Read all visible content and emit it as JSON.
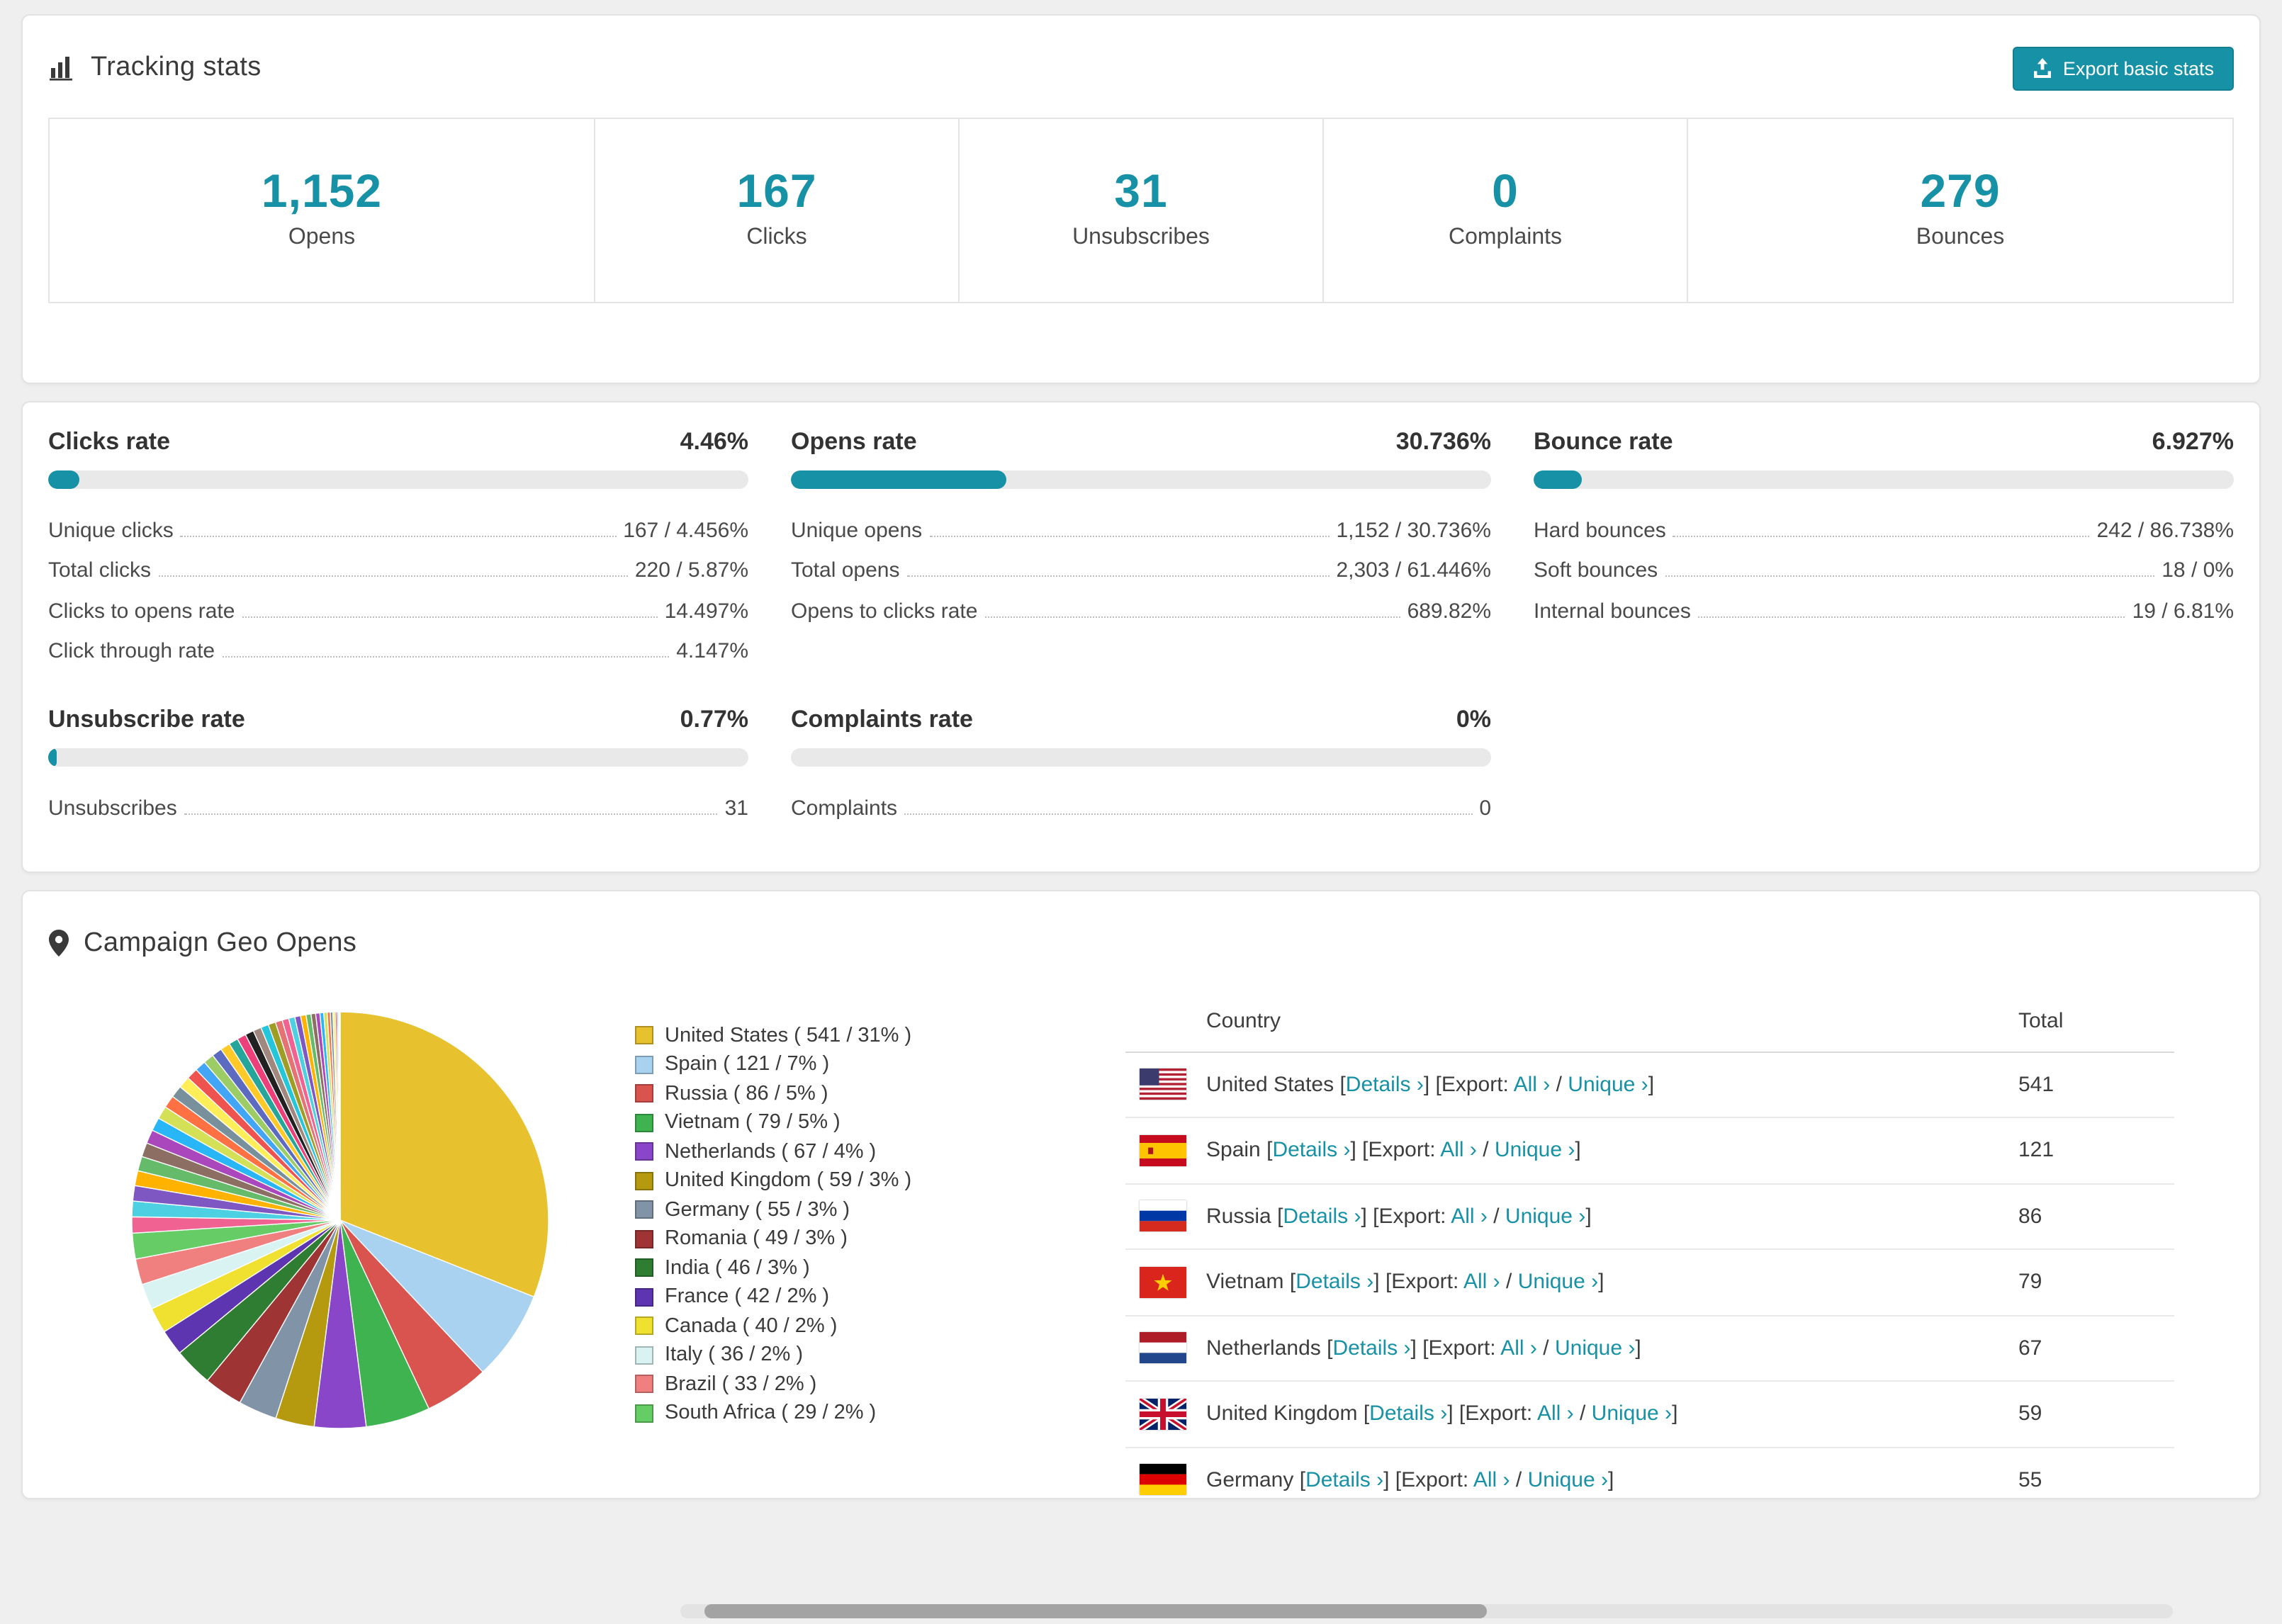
{
  "app": {
    "accent_color": "#1791a5",
    "background_color": "#efefef"
  },
  "tracking": {
    "title": "Tracking stats",
    "export_button": "Export basic stats",
    "stats": [
      {
        "value": "1,152",
        "label": "Opens"
      },
      {
        "value": "167",
        "label": "Clicks"
      },
      {
        "value": "31",
        "label": "Unsubscribes"
      },
      {
        "value": "0",
        "label": "Complaints"
      },
      {
        "value": "279",
        "label": "Bounces"
      }
    ]
  },
  "rates": {
    "panels": [
      {
        "title": "Clicks rate",
        "value": "4.46%",
        "percent": 4.46,
        "rows": [
          {
            "label": "Unique clicks",
            "value": "167 / 4.456%"
          },
          {
            "label": "Total clicks",
            "value": "220 / 5.87%"
          },
          {
            "label": "Clicks to opens rate",
            "value": "14.497%"
          },
          {
            "label": "Click through rate",
            "value": "4.147%"
          }
        ]
      },
      {
        "title": "Opens rate",
        "value": "30.736%",
        "percent": 30.736,
        "rows": [
          {
            "label": "Unique opens",
            "value": "1,152 / 30.736%"
          },
          {
            "label": "Total opens",
            "value": "2,303 / 61.446%"
          },
          {
            "label": "Opens to clicks rate",
            "value": "689.82%"
          }
        ]
      },
      {
        "title": "Bounce rate",
        "value": "6.927%",
        "percent": 6.927,
        "rows": [
          {
            "label": "Hard bounces",
            "value": "242 / 86.738%"
          },
          {
            "label": "Soft bounces",
            "value": "18 / 0%"
          },
          {
            "label": "Internal bounces",
            "value": "19 / 6.81%"
          }
        ]
      },
      {
        "title": "Unsubscribe rate",
        "value": "0.77%",
        "percent": 0.77,
        "rows": [
          {
            "label": "Unsubscribes",
            "value": "31"
          }
        ]
      },
      {
        "title": "Complaints rate",
        "value": "0%",
        "percent": 0,
        "rows": [
          {
            "label": "Complaints",
            "value": "0"
          }
        ]
      }
    ]
  },
  "geo": {
    "title": "Campaign Geo Opens",
    "table": {
      "country_header": "Country",
      "total_header": "Total",
      "details_label": "Details ›",
      "export_prefix": "[Export:",
      "all_label": "All ›",
      "slash": "/",
      "unique_label": "Unique ›",
      "bracket_open": "[",
      "bracket_close": "]",
      "rows": [
        {
          "country": "United States",
          "flag": "us",
          "total": "541"
        },
        {
          "country": "Spain",
          "flag": "es",
          "total": "121"
        },
        {
          "country": "Russia",
          "flag": "ru",
          "total": "86"
        },
        {
          "country": "Vietnam",
          "flag": "vn",
          "total": "79"
        },
        {
          "country": "Netherlands",
          "flag": "nl",
          "total": "67"
        },
        {
          "country": "United Kingdom",
          "flag": "gb",
          "total": "59"
        },
        {
          "country": "Germany",
          "flag": "de",
          "total": "55"
        }
      ]
    }
  },
  "chart_data": {
    "type": "pie",
    "title": "Campaign Geo Opens",
    "legend_position": "right",
    "labels": [
      "United States",
      "Spain",
      "Russia",
      "Vietnam",
      "Netherlands",
      "United Kingdom",
      "Germany",
      "Romania",
      "India",
      "France",
      "Canada",
      "Italy",
      "Brazil",
      "South Africa"
    ],
    "values": [
      541,
      121,
      86,
      79,
      67,
      59,
      55,
      49,
      46,
      42,
      40,
      36,
      33,
      29
    ],
    "percents": [
      31,
      7,
      5,
      5,
      4,
      3,
      3,
      3,
      3,
      2,
      2,
      2,
      2,
      2
    ],
    "colors": [
      "#e8c22e",
      "#a8d2f0",
      "#d9534f",
      "#3eb34f",
      "#8a46c8",
      "#b5990f",
      "#8193a6",
      "#9e3434",
      "#2e7d32",
      "#5e35b1",
      "#f0e130",
      "#d9f2f2",
      "#f08080",
      "#66cc66"
    ],
    "others": {
      "percent": 26,
      "slices": 40,
      "max_slice_pct": 1.25,
      "min_slice_pct": 0.05,
      "palette": [
        "#f06292",
        "#4dd0e1",
        "#7e57c2",
        "#ffb300",
        "#66bb6a",
        "#8d6e63",
        "#ab47bc",
        "#29b6f6",
        "#d4e157",
        "#ff7043",
        "#78909c",
        "#ffee58",
        "#ef5350",
        "#42a5f5",
        "#9ccc65",
        "#5c6bc0",
        "#ffca28",
        "#26a69a",
        "#ec407a",
        "#212121",
        "#a1887f",
        "#26c6da",
        "#9e9d24",
        "#e57373"
      ]
    }
  }
}
